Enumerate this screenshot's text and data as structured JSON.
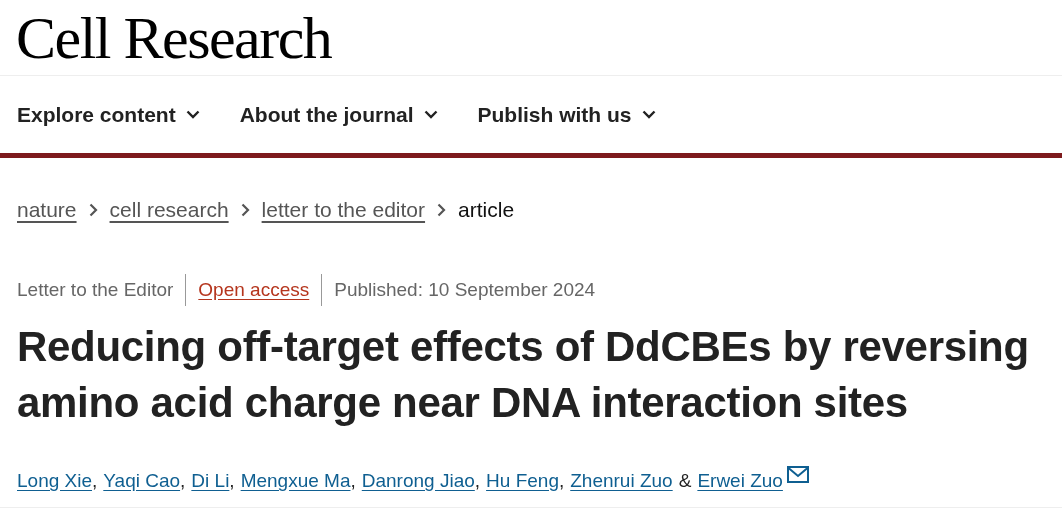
{
  "journal_title": "Cell Research",
  "nav": [
    {
      "label": "Explore content"
    },
    {
      "label": "About the journal"
    },
    {
      "label": "Publish with us"
    }
  ],
  "breadcrumbs": [
    {
      "label": "nature",
      "link": true
    },
    {
      "label": "cell research",
      "link": true
    },
    {
      "label": "letter to the editor",
      "link": true
    },
    {
      "label": "article",
      "link": false
    }
  ],
  "article_type": "Letter to the Editor",
  "access": "Open access",
  "published": "Published: 10 September 2024",
  "title": "Reducing off-target effects of DdCBEs by reversing amino acid charge near DNA interaction sites",
  "authors": [
    {
      "name": "Long Xie",
      "corresponding": false
    },
    {
      "name": "Yaqi Cao",
      "corresponding": false,
      "joiner": ","
    },
    {
      "name": "Di Li",
      "corresponding": false,
      "joiner": ","
    },
    {
      "name": "Mengxue Ma",
      "corresponding": false,
      "joiner": ","
    },
    {
      "name": "Danrong Jiao",
      "corresponding": false,
      "joiner": ","
    },
    {
      "name": "Hu Feng",
      "corresponding": false,
      "joiner": ","
    },
    {
      "name": "Zhenrui Zuo",
      "corresponding": false,
      "joiner": ","
    },
    {
      "name": "Erwei Zuo",
      "corresponding": true,
      "joiner": "&"
    }
  ]
}
